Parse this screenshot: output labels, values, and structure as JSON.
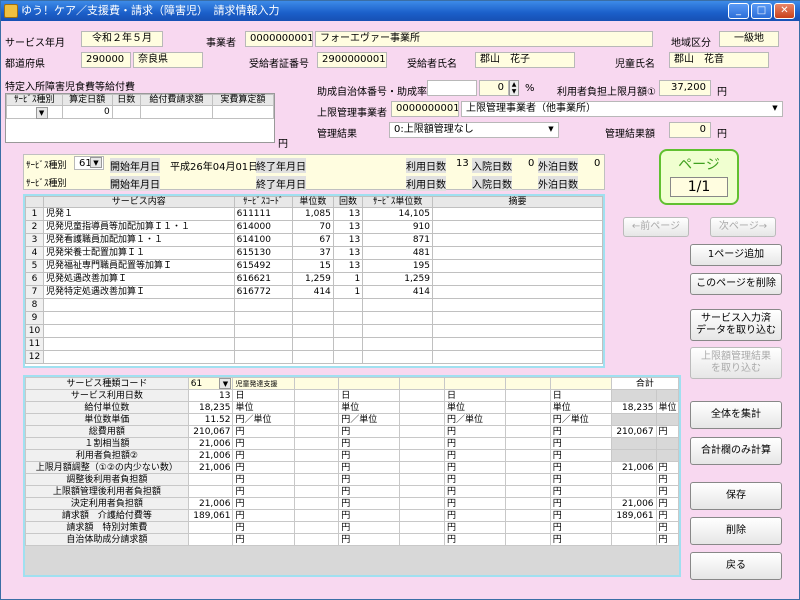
{
  "window": {
    "title": "ゆう！ケア／支援費・請求（障害児）　請求情報入力"
  },
  "header": {
    "service_ym_label": "サービス年月",
    "service_ym": "令和２年５月",
    "office_label": "事業者",
    "office_code": "0000000001",
    "office_name": "フォーエヴァー事業所",
    "area_label": "地域区分",
    "area": "一級地",
    "pref_label": "都道府県",
    "pref_code": "290000",
    "pref_name": "奈良県",
    "cert_label": "受給者証番号",
    "cert_no": "2900000001",
    "recipient_label": "受給者氏名",
    "recipient": "郡山　花子",
    "child_label": "児童氏名",
    "child": "郡山　花音"
  },
  "meal": {
    "title": "特定入所障害児食費等給付費",
    "cols": [
      "ｻｰﾋﾞｽ種別",
      "算定日額",
      "日数",
      "給付費請求額",
      "実費算定額"
    ],
    "days": "0",
    "yen": "円"
  },
  "subsidy": {
    "label": "助成自治体番号・助成率",
    "rate": "0",
    "pct": "%",
    "limit_label": "利用者負担上限月額①",
    "limit": "37,200",
    "yen": "円"
  },
  "upper": {
    "label": "上限管理事業者",
    "code": "0000000001",
    "name": "上限管理事業者（他事業所）"
  },
  "result": {
    "label": "管理結果",
    "value": "0:上限額管理なし",
    "amt_label": "管理結果額",
    "amt": "0",
    "yen": "円"
  },
  "svc": {
    "row1": {
      "type_label": "ｻｰﾋﾞｽ種別",
      "type": "61",
      "start_label": "開始年月日",
      "start": "平成26年04月01日",
      "end_label": "終了年月日",
      "use_label": "利用日数",
      "use": "13",
      "in_label": "入院日数",
      "in": "0",
      "out_label": "外泊日数",
      "out": "0"
    },
    "row2": {
      "type_label": "ｻｰﾋﾞｽ種別",
      "start_label": "開始年月日",
      "end_label": "終了年月日",
      "use_label": "利用日数",
      "in_label": "入院日数",
      "out_label": "外泊日数"
    }
  },
  "page": {
    "label": "ページ",
    "value": "1/1"
  },
  "grid": {
    "headers": [
      "サービス内容",
      "ｻｰﾋﾞｽｺｰﾄﾞ",
      "単位数",
      "回数",
      "ｻｰﾋﾞｽ単位数",
      "摘要"
    ],
    "rows": [
      {
        "no": "1",
        "name": "児発１",
        "code": "611111",
        "unit": "1,085",
        "count": "13",
        "total": "14,105"
      },
      {
        "no": "2",
        "name": "児発児童指導員等加配加算Ｉ１・１",
        "code": "614000",
        "unit": "70",
        "count": "13",
        "total": "910"
      },
      {
        "no": "3",
        "name": "児発看護職員加配加算１・１",
        "code": "614100",
        "unit": "67",
        "count": "13",
        "total": "871"
      },
      {
        "no": "4",
        "name": "児発栄養士配置加算Ｉ１",
        "code": "615130",
        "unit": "37",
        "count": "13",
        "total": "481"
      },
      {
        "no": "5",
        "name": "児発福祉専門職員配置等加算Ｉ",
        "code": "615492",
        "unit": "15",
        "count": "13",
        "total": "195"
      },
      {
        "no": "6",
        "name": "児発処遇改善加算Ｉ",
        "code": "616621",
        "unit": "1,259",
        "count": "1",
        "total": "1,259"
      },
      {
        "no": "7",
        "name": "児発特定処遇改善加算Ｉ",
        "code": "616772",
        "unit": "414",
        "count": "1",
        "total": "414"
      },
      {
        "no": "8"
      },
      {
        "no": "9"
      },
      {
        "no": "10"
      },
      {
        "no": "11"
      },
      {
        "no": "12"
      }
    ]
  },
  "buttons": {
    "prev": "←前ページ",
    "next": "次ページ→",
    "add_page": "1ページ追加",
    "del_page": "このページを削除",
    "svc_import": "サービス入力済\nデータを取り込む",
    "limit_import": "上限額管理結果\nを取り込む",
    "calc_all": "全体を集計",
    "calc_total": "合計欄のみ計算",
    "save": "保存",
    "delete": "削除",
    "back": "戻る"
  },
  "calc": {
    "code_label": "サービス種類コード",
    "code": "61",
    "code_name": "児童発達支援",
    "total_label": "合計",
    "rows": [
      {
        "label": "サービス利用日数",
        "v": "13",
        "u": "日",
        "u2": "日",
        "u3": "日",
        "u4": "日",
        "t": "",
        "tu": ""
      },
      {
        "label": "給付単位数",
        "v": "18,235",
        "u": "単位",
        "u2": "単位",
        "u3": "単位",
        "u4": "単位",
        "t": "18,235",
        "tu": "単位"
      },
      {
        "label": "単位数単価",
        "v": "11.52",
        "u": "円／単位",
        "u2": "円／単位",
        "u3": "円／単位",
        "u4": "円／単位",
        "t": "",
        "tu": ""
      },
      {
        "label": "総費用額",
        "v": "210,067",
        "u": "円",
        "u2": "円",
        "u3": "円",
        "u4": "円",
        "t": "210,067",
        "tu": "円"
      },
      {
        "label": "１割相当額",
        "v": "21,006",
        "u": "円",
        "u2": "円",
        "u3": "円",
        "u4": "円",
        "t": "",
        "tu": ""
      },
      {
        "label": "利用者負担額②",
        "v": "21,006",
        "u": "円",
        "u2": "円",
        "u3": "円",
        "u4": "円",
        "t": "",
        "tu": ""
      },
      {
        "label": "上限月額調整（①②の内少ない数）",
        "v": "21,006",
        "u": "円",
        "u2": "円",
        "u3": "円",
        "u4": "円",
        "t": "21,006",
        "tu": "円"
      },
      {
        "label": "調整後利用者負担額",
        "v": "",
        "u": "円",
        "u2": "円",
        "u3": "円",
        "u4": "円",
        "t": "",
        "tu": "円"
      },
      {
        "label": "上限額管理後利用者負担額",
        "v": "",
        "u": "円",
        "u2": "円",
        "u3": "円",
        "u4": "円",
        "t": "",
        "tu": "円"
      },
      {
        "label": "決定利用者負担額",
        "v": "21,006",
        "u": "円",
        "u2": "円",
        "u3": "円",
        "u4": "円",
        "t": "21,006",
        "tu": "円"
      },
      {
        "label": "請求額　介護給付費等",
        "v": "189,061",
        "u": "円",
        "u2": "円",
        "u3": "円",
        "u4": "円",
        "t": "189,061",
        "tu": "円"
      },
      {
        "label": "請求額　特別対策費",
        "v": "",
        "u": "円",
        "u2": "円",
        "u3": "円",
        "u4": "円",
        "t": "",
        "tu": "円"
      },
      {
        "label": "自治体助成分請求額",
        "v": "",
        "u": "円",
        "u2": "円",
        "u3": "円",
        "u4": "円",
        "t": "",
        "tu": "円"
      }
    ]
  }
}
